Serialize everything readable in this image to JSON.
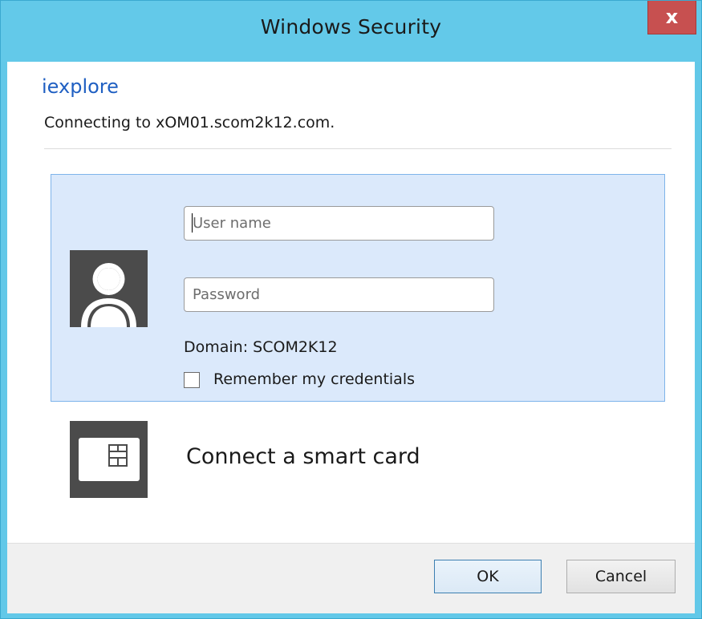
{
  "window": {
    "title": "Windows Security",
    "close_symbol": "x",
    "accent_color": "#63c9e9",
    "close_color": "#c75050"
  },
  "prompt": {
    "app_name": "iexplore",
    "message": "Connecting to xOM01.scom2k12.com."
  },
  "credentials": {
    "username_placeholder": "User name",
    "username_value": "",
    "password_placeholder": "Password",
    "password_value": "",
    "domain_text": "Domain: SCOM2K12",
    "remember_label": "Remember my credentials",
    "remember_checked": false,
    "user_icon": "user-silhouette-icon",
    "tile_color": "#dbe9fb"
  },
  "smart_card": {
    "label": "Connect a smart card",
    "icon": "smart-card-icon"
  },
  "buttons": {
    "ok_label": "OK",
    "cancel_label": "Cancel"
  }
}
